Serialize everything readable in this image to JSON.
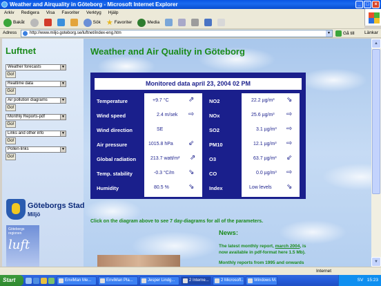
{
  "window": {
    "title": "Weather and Airquality in Göteborg - Microsoft Internet Explorer"
  },
  "menu": [
    "Arkiv",
    "Redigera",
    "Visa",
    "Favoriter",
    "Verktyg",
    "Hjälp"
  ],
  "toolbar": {
    "back": "Bakåt",
    "search": "Sök",
    "favorites": "Favoriter",
    "media": "Media"
  },
  "address": {
    "label": "Adress",
    "url": "http://www.miljo.goteborg.se/luftnet/index-eng.htm",
    "go": "Gå till",
    "links": "Länkar"
  },
  "sidebar": {
    "title": "Luftnet",
    "selects": [
      "Weather forecasts",
      "Realtime data",
      "Air pollution diagrams",
      "Monthly Reports-pdf",
      "Links and other info",
      "Pollen-links"
    ],
    "go_label": "Go!",
    "logo_name": "Göteborgs Stad",
    "logo_sub": "Miljö",
    "luft_small": "Göteborgs regionen",
    "luft_big": "luft"
  },
  "main": {
    "title": "Weather and Air Quality in Göteborg",
    "panel_header": "Monitored data april 23, 2004 02 PM",
    "rows": [
      {
        "label": "Temperature",
        "value": "+9.7 °C",
        "arrow": "⇗",
        "p_label": "NO2",
        "p_value": "22.2 µg/m³",
        "p_arrow": "⇘"
      },
      {
        "label": "Wind speed",
        "value": "2.4 m/sek",
        "arrow": "⇨",
        "p_label": "NOx",
        "p_value": "25.6 µg/m³",
        "p_arrow": "⇨"
      },
      {
        "label": "Wind direction",
        "value": "SE",
        "arrow": "",
        "p_label": "SO2",
        "p_value": "3.1 µg/m³",
        "p_arrow": "⇨"
      },
      {
        "label": "Air pressure",
        "value": "1015.8 hPa",
        "arrow": "⇙",
        "p_label": "PM10",
        "p_value": "12.1 µg/m³",
        "p_arrow": "⇨"
      },
      {
        "label": "Global radiation",
        "value": "213.7 watt/m²",
        "arrow": "⇗",
        "p_label": "O3",
        "p_value": "63.7 µg/m³",
        "p_arrow": "⇙"
      },
      {
        "label": "Temp. stability",
        "value": "-0.3 °C/m",
        "arrow": "⇘",
        "p_label": "CO",
        "p_value": "0.0 µg/m³",
        "p_arrow": "⇨"
      },
      {
        "label": "Humidity",
        "value": "80.5 %",
        "arrow": "⇘",
        "p_label": "Index",
        "p_value": "Low levels",
        "p_arrow": "⇘"
      }
    ],
    "click_note": "Click on the diagram above to see 7 day-diagrams for all of the parameters.",
    "news_title": "News:",
    "news_line1_a": "The latest monthly report, ",
    "news_link": "march 2004",
    "news_line1_b": ", is",
    "news_line2": "now available in pdf-format here 1.5 Mb).",
    "news_line3": "Monthly reports from 1995 and onwards"
  },
  "status": {
    "zone": "Internet"
  },
  "taskbar": {
    "start": "Start",
    "tasks": [
      "EnviMan Me...",
      "EnviMan Pla...",
      "Jesper Lindg...",
      "2 Interne...",
      "2 Microsoft...",
      "Windows M..."
    ],
    "clock": "15:23",
    "lang": "SV"
  }
}
